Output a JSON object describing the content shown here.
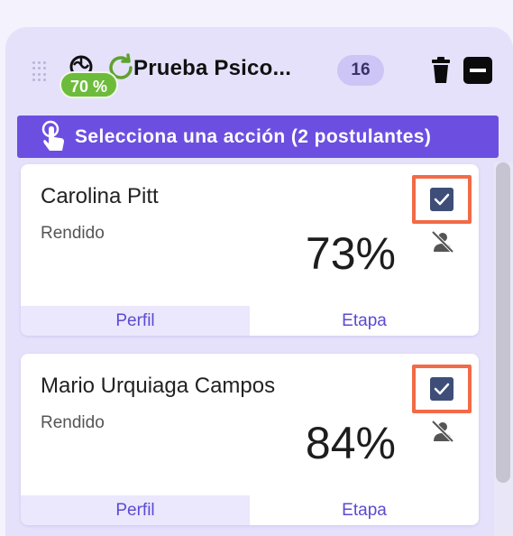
{
  "column": {
    "percent_badge": "70 %",
    "title": "Prueba Psico...",
    "count": "16",
    "action_bar_label": "Selecciona una acción (2 postulantes)",
    "icons": [
      "drag-handle-icon",
      "brain-icon",
      "refresh-icon",
      "trash-icon",
      "collapse-icon",
      "touch-hand-icon"
    ]
  },
  "cards": [
    {
      "name": "Carolina Pitt",
      "status": "Rendido",
      "score": "73%",
      "selected": true,
      "tab_profile": "Perfil",
      "tab_stage": "Etapa"
    },
    {
      "name": "Mario Urquiaga Campos",
      "status": "Rendido",
      "score": "84%",
      "selected": true,
      "tab_profile": "Perfil",
      "tab_stage": "Etapa"
    }
  ],
  "colors": {
    "accent": "#6c4fe0",
    "badge_green": "#6dbb3a",
    "highlight": "#f26a46",
    "checkbox": "#3f4e78"
  }
}
